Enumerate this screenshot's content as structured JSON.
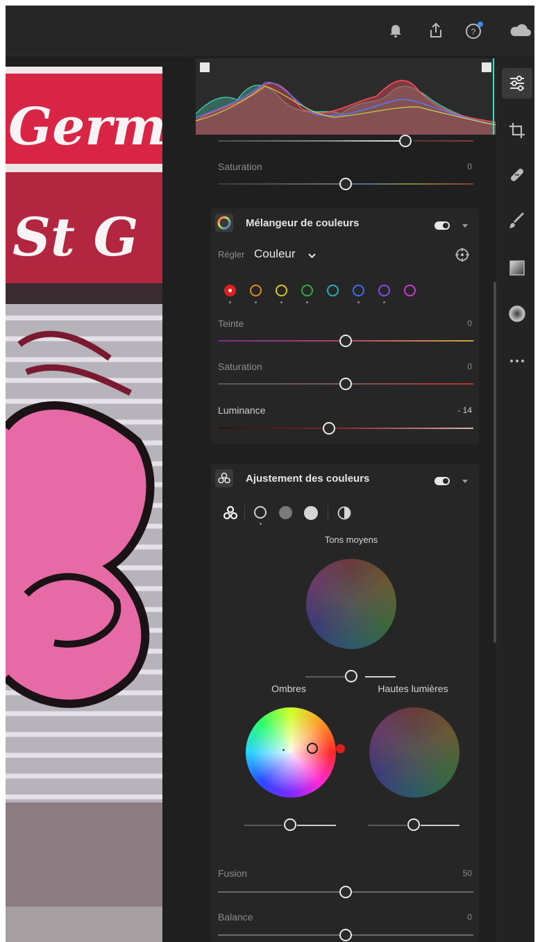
{
  "colors": {
    "app_bg": "#1f1f1f",
    "card_bg": "#262626",
    "accent_blue": "#3a86ff",
    "red_dot": "#e02020"
  },
  "topbar": {
    "icons": [
      "bell-icon",
      "share-icon",
      "help-icon",
      "cloud-icon"
    ]
  },
  "upper": {
    "saturation_label": "Saturation",
    "saturation_value": "0"
  },
  "color_mixer": {
    "title": "Mélangeur de couleurs",
    "adjust_label": "Régler",
    "adjust_value": "Couleur",
    "swatches": [
      "red",
      "orange",
      "yellow",
      "green",
      "aqua",
      "blue",
      "purple",
      "magenta"
    ],
    "sliders": [
      {
        "label": "Teinte",
        "value": "0"
      },
      {
        "label": "Saturation",
        "value": "0"
      },
      {
        "label": "Luminance",
        "value": "- 14"
      }
    ]
  },
  "color_grading": {
    "title": "Ajustement des couleurs",
    "midtones_label": "Tons moyens",
    "shadows_label": "Ombres",
    "highlights_label": "Hautes lumières",
    "sliders": [
      {
        "label": "Fusion",
        "value": "50"
      },
      {
        "label": "Balance",
        "value": "0"
      }
    ]
  },
  "right_toolbar": {
    "icons": [
      "edit-sliders-icon",
      "crop-icon",
      "healing-icon",
      "brush-icon",
      "linear-gradient-icon",
      "radial-gradient-icon",
      "more-icon"
    ]
  }
}
